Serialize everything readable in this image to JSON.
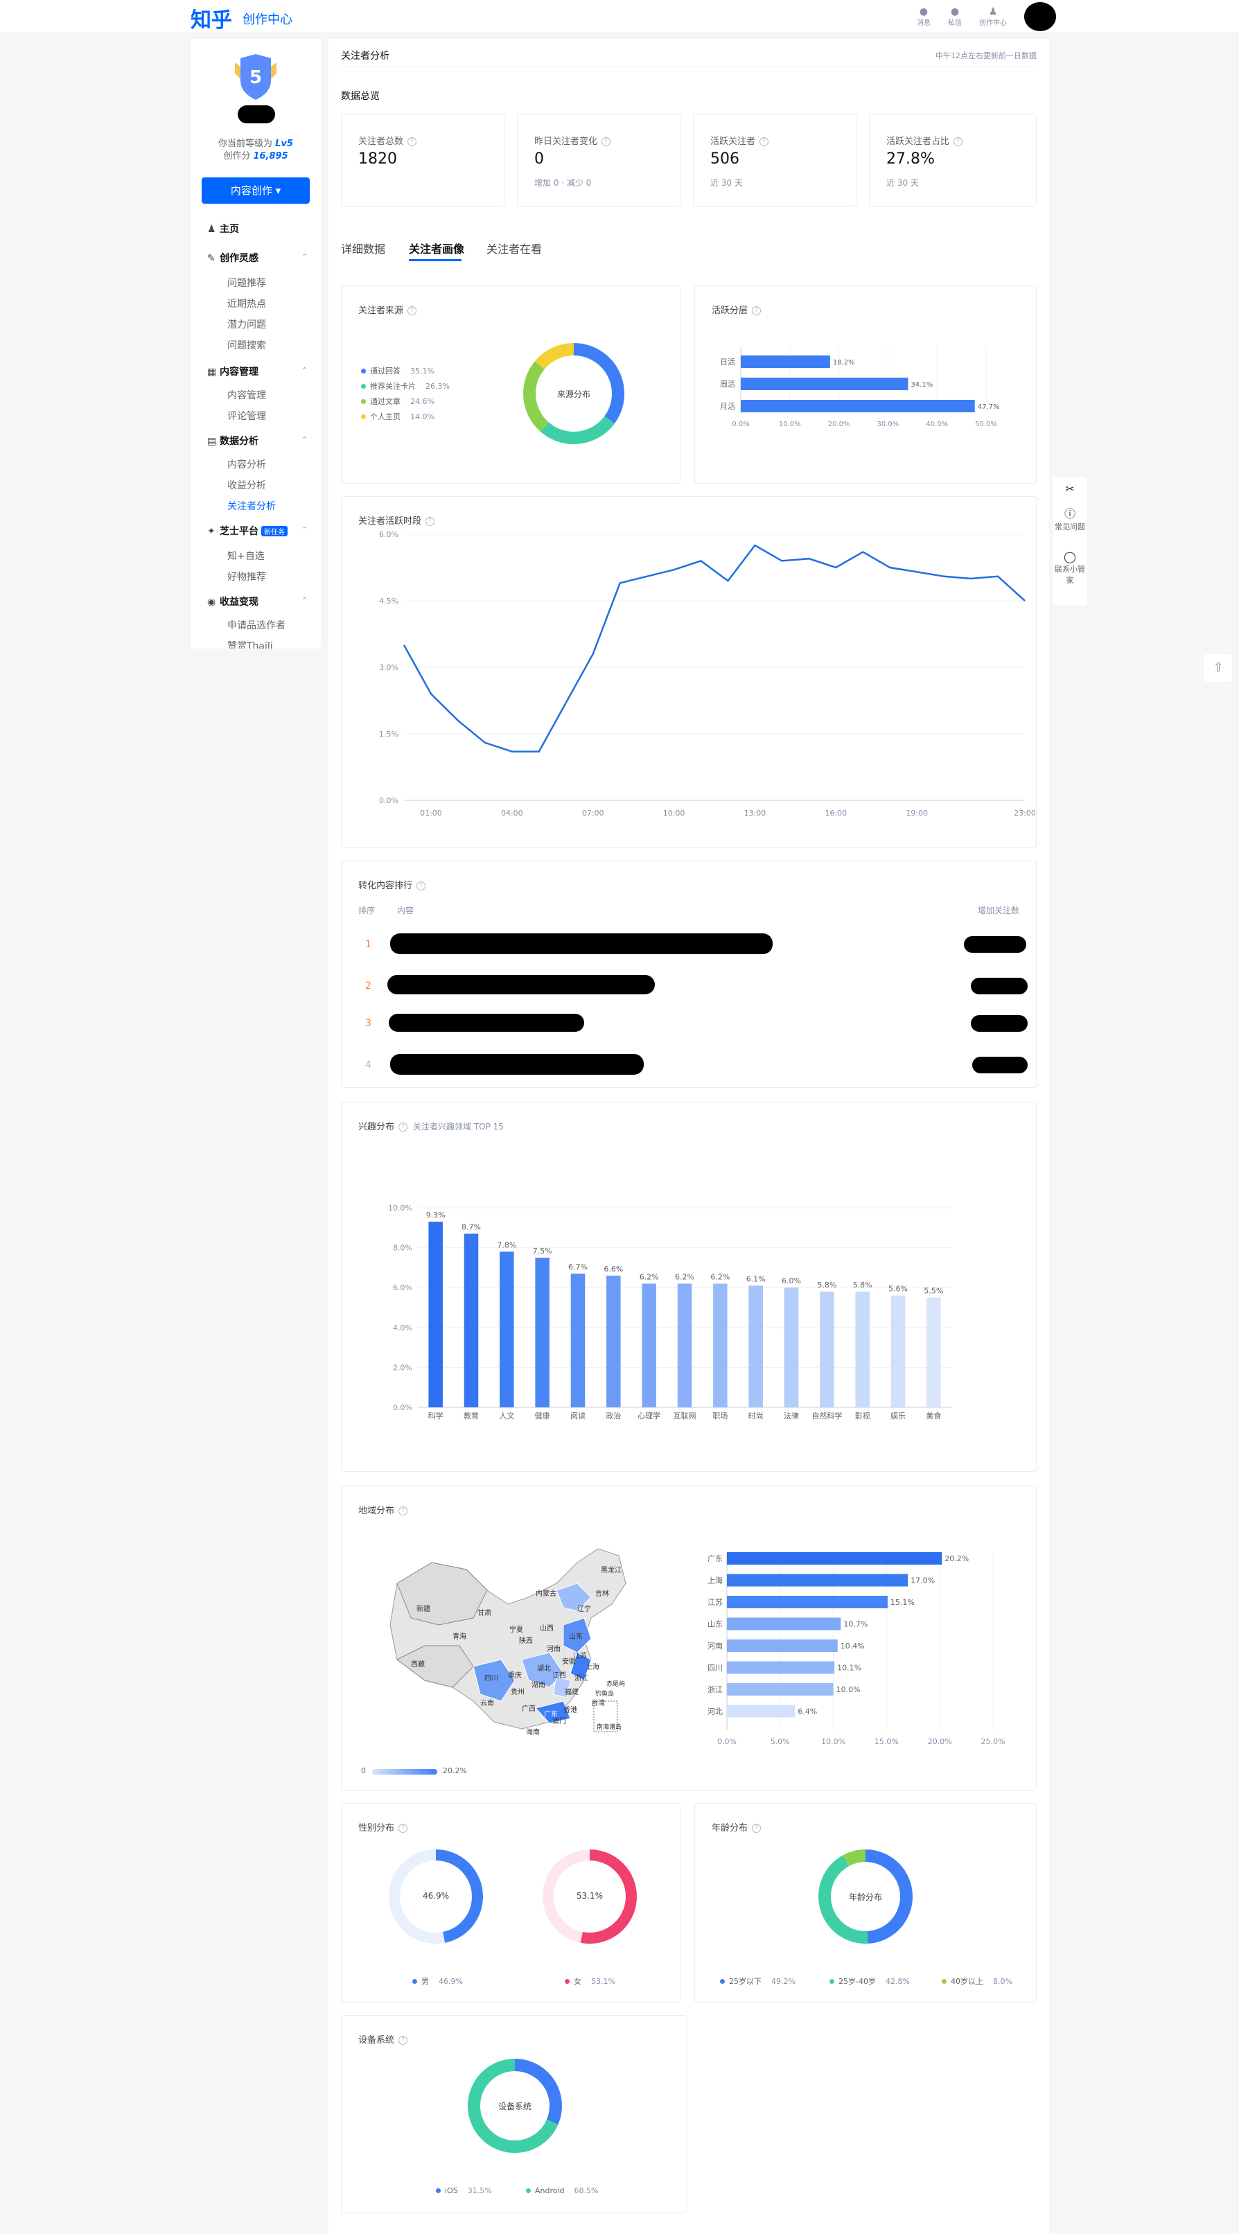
{
  "header": {
    "logo": "知乎",
    "subtitle": "创作中心",
    "icons": [
      {
        "name": "bell-icon",
        "label": "消息"
      },
      {
        "name": "chat-icon",
        "label": "私信"
      },
      {
        "name": "user-icon",
        "label": "创作中心"
      }
    ]
  },
  "sidebar": {
    "level_text": "你当前等级为",
    "level_value": "Lv5",
    "score_text": "创作分",
    "score_value": "16,895",
    "badge_number": "5",
    "create_button": "内容创作 ▾",
    "home": "主页",
    "sections": [
      {
        "title": "创作灵感",
        "items": [
          "问题推荐",
          "近期热点",
          "潜力问题",
          "问题搜索"
        ]
      },
      {
        "title": "内容管理",
        "items": [
          "内容管理",
          "评论管理"
        ]
      },
      {
        "title": "数据分析",
        "items": [
          "内容分析",
          "收益分析",
          "关注者分析"
        ]
      },
      {
        "title": "芝士平台",
        "tag": "新任务",
        "items": [
          "知+自选",
          "好物推荐"
        ]
      },
      {
        "title": "收益变现",
        "items": [
          "申请品选作者",
          "赞赏Thaili"
        ]
      }
    ]
  },
  "page": {
    "title": "关注者分析",
    "update_note": "中午12点左右更新前一日数据",
    "overview_title": "数据总览"
  },
  "stats": [
    {
      "label": "关注者总数",
      "value": "1820",
      "sub": ""
    },
    {
      "label": "昨日关注者变化",
      "value": "0",
      "sub": "增加 0 · 减少 0"
    },
    {
      "label": "活跃关注者",
      "value": "506",
      "sub": "近 30 天"
    },
    {
      "label": "活跃关注者占比",
      "value": "27.8%",
      "sub": "近 30 天"
    }
  ],
  "tabs": [
    "详细数据",
    "关注者画像",
    "关注者在看"
  ],
  "source": {
    "title": "关注者来源",
    "center_label": "来源分布",
    "items": [
      {
        "name": "通过回答",
        "value": "35.1%",
        "pct": 35.1,
        "color": "#3d7ef7"
      },
      {
        "name": "推荐关注卡片",
        "value": "26.3%",
        "pct": 26.3,
        "color": "#3ecfa6"
      },
      {
        "name": "通过文章",
        "value": "24.6%",
        "pct": 24.6,
        "color": "#8bd14b"
      },
      {
        "name": "个人主页",
        "value": "14.0%",
        "pct": 14.0,
        "color": "#f5d033"
      }
    ]
  },
  "activity": {
    "title": "活跃分层",
    "rows": [
      {
        "name": "日活",
        "value": 18.2,
        "label": "18.2%"
      },
      {
        "name": "周活",
        "value": 34.1,
        "label": "34.1%"
      },
      {
        "name": "月活",
        "value": 47.7,
        "label": "47.7%"
      }
    ],
    "ticks": [
      "0.0%",
      "10.0%",
      "20.0%",
      "30.0%",
      "40.0%",
      "50.0%"
    ]
  },
  "active_time": {
    "title": "关注者活跃时段",
    "yticks": [
      "0.0%",
      "1.5%",
      "3.0%",
      "4.5%",
      "6.0%"
    ],
    "xticks": [
      "01:00",
      "04:00",
      "07:00",
      "10:00",
      "13:00",
      "16:00",
      "19:00",
      "23:00"
    ]
  },
  "ranking": {
    "title": "转化内容排行",
    "col_rank": "排序",
    "col_content": "内容",
    "col_gain": "增加关注数",
    "ranks": [
      "1",
      "2",
      "3",
      "4"
    ]
  },
  "interest": {
    "title": "兴趣分布",
    "hint": "关注者兴趣领域 TOP 15",
    "yticks": [
      "0.0%",
      "2.0%",
      "4.0%",
      "6.0%",
      "8.0%",
      "10.0%"
    ]
  },
  "region": {
    "title": "地域分布",
    "legend_min": "0",
    "legend_max": "20.2%",
    "map_labels": [
      "新疆",
      "西藏",
      "青海",
      "甘肃",
      "内蒙古",
      "黑龙江",
      "吉林",
      "辽宁",
      "宁夏",
      "山西",
      "陕西",
      "四川",
      "重庆",
      "湖北",
      "河南",
      "山东",
      "江苏",
      "上海",
      "浙江",
      "福建",
      "广东",
      "广西",
      "云南",
      "贵州",
      "湖南",
      "江西",
      "安徽",
      "台湾",
      "海南",
      "香港",
      "澳门"
    ],
    "map_extra": "赤尾屿",
    "map_extra2": "钓鱼岛",
    "map_extra3": "南海诸岛",
    "bar_ticks": [
      "0.0%",
      "5.0%",
      "10.0%",
      "15.0%",
      "20.0%",
      "25.0%"
    ]
  },
  "gender": {
    "title": "性别分布",
    "male": {
      "label": "男",
      "value": "46.9%",
      "pct": 46.9,
      "color": "#3d7ef7"
    },
    "female": {
      "label": "女",
      "value": "53.1%",
      "pct": 53.1,
      "color": "#f0406c"
    }
  },
  "age": {
    "title": "年龄分布",
    "center_label": "年龄分布",
    "items": [
      {
        "name": "25岁以下",
        "value": "49.2%",
        "pct": 49.2,
        "color": "#3d7ef7"
      },
      {
        "name": "25岁-40岁",
        "value": "42.8%",
        "pct": 42.8,
        "color": "#3ecfa6"
      },
      {
        "name": "40岁以上",
        "value": "8.0%",
        "pct": 8.0,
        "color": "#8bd14b"
      }
    ]
  },
  "device": {
    "title": "设备系统",
    "center_label": "设备系统",
    "items": [
      {
        "name": "iOS",
        "value": "31.5%",
        "pct": 31.5,
        "color": "#3d7ef7"
      },
      {
        "name": "Android",
        "value": "68.5%",
        "pct": 68.5,
        "color": "#3ecfa6"
      }
    ]
  },
  "side_tools": [
    "常见问题",
    "联系小管家"
  ],
  "chart_data": [
    {
      "type": "pie",
      "title": "关注者来源",
      "categories": [
        "通过回答",
        "推荐关注卡片",
        "通过文章",
        "个人主页"
      ],
      "values": [
        35.1,
        26.3,
        24.6,
        14.0
      ]
    },
    {
      "type": "bar",
      "title": "活跃分层",
      "categories": [
        "日活",
        "周活",
        "月活"
      ],
      "values": [
        18.2,
        34.1,
        47.7
      ],
      "xlim": [
        0,
        50
      ]
    },
    {
      "type": "line",
      "title": "关注者活跃时段",
      "x": [
        "00:00",
        "01:00",
        "02:00",
        "03:00",
        "04:00",
        "05:00",
        "06:00",
        "07:00",
        "08:00",
        "09:00",
        "10:00",
        "11:00",
        "12:00",
        "13:00",
        "14:00",
        "15:00",
        "16:00",
        "17:00",
        "18:00",
        "19:00",
        "20:00",
        "21:00",
        "22:00",
        "23:00"
      ],
      "values": [
        3.5,
        2.4,
        1.8,
        1.3,
        1.1,
        1.1,
        2.2,
        3.3,
        4.9,
        5.05,
        5.2,
        5.4,
        4.95,
        5.75,
        5.4,
        5.45,
        5.25,
        5.6,
        5.25,
        5.15,
        5.05,
        5.0,
        5.05,
        4.5
      ],
      "ylim": [
        0,
        6
      ],
      "grid": true
    },
    {
      "type": "bar",
      "title": "兴趣分布",
      "categories": [
        "科学",
        "教育",
        "人文",
        "健康",
        "阅读",
        "政治",
        "心理学",
        "互联网",
        "职场",
        "时尚",
        "法律",
        "自然科学",
        "影视",
        "娱乐",
        "美食"
      ],
      "values": [
        9.3,
        8.7,
        7.8,
        7.5,
        6.7,
        6.6,
        6.2,
        6.2,
        6.2,
        6.1,
        6.0,
        5.8,
        5.8,
        5.6,
        5.5
      ],
      "labels": [
        "9.3%",
        "8.7%",
        "7.8%",
        "7.5%",
        "6.7%",
        "6.6%",
        "6.2%",
        "6.2%",
        "6.2%",
        "6.1%",
        "6.0%",
        "5.8%",
        "5.8%",
        "5.6%",
        "5.5%"
      ],
      "ylim": [
        0,
        10
      ]
    },
    {
      "type": "bar",
      "title": "地域分布",
      "categories": [
        "广东",
        "上海",
        "江苏",
        "山东",
        "河南",
        "四川",
        "浙江",
        "河北"
      ],
      "values": [
        20.2,
        17.0,
        15.1,
        10.7,
        10.4,
        10.1,
        10.0,
        6.4
      ],
      "labels": [
        "20.2%",
        "17.0%",
        "15.1%",
        "10.7%",
        "10.4%",
        "10.1%",
        "10.0%",
        "6.4%"
      ],
      "xlim": [
        0,
        25
      ]
    },
    {
      "type": "pie",
      "title": "性别分布",
      "categories": [
        "男",
        "女"
      ],
      "values": [
        46.9,
        53.1
      ]
    },
    {
      "type": "pie",
      "title": "年龄分布",
      "categories": [
        "25岁以下",
        "25岁-40岁",
        "40岁以上"
      ],
      "values": [
        49.2,
        42.8,
        8.0
      ]
    },
    {
      "type": "pie",
      "title": "设备系统",
      "categories": [
        "iOS",
        "Android"
      ],
      "values": [
        31.5,
        68.5
      ]
    }
  ]
}
